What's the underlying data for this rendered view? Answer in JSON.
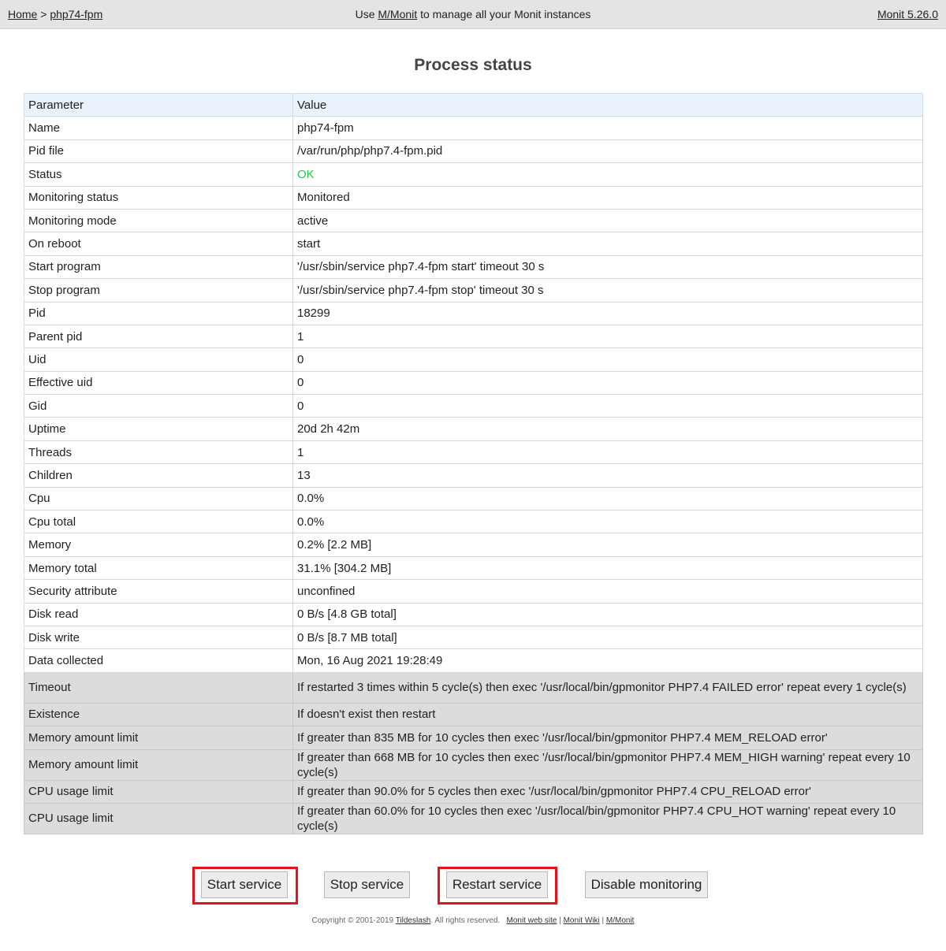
{
  "header": {
    "home": "Home",
    "separator": ">",
    "service": "php74-fpm",
    "promo_prefix": "Use",
    "promo_link": "M/Monit",
    "promo_suffix": "to manage all your Monit instances",
    "version": "Monit 5.26.0"
  },
  "page_title": "Process status",
  "table": {
    "head": [
      "Parameter",
      "Value"
    ],
    "rows": [
      [
        "Name",
        "php74-fpm"
      ],
      [
        "Pid file",
        "/var/run/php/php7.4-fpm.pid"
      ],
      [
        "Status",
        "OK"
      ],
      [
        "Monitoring status",
        "Monitored"
      ],
      [
        "Monitoring mode",
        "active"
      ],
      [
        "On reboot",
        "start"
      ],
      [
        "Start program",
        "'/usr/sbin/service php7.4-fpm start' timeout 30 s"
      ],
      [
        "Stop program",
        "'/usr/sbin/service php7.4-fpm stop' timeout 30 s"
      ],
      [
        "Pid",
        "18299"
      ],
      [
        "Parent pid",
        "1"
      ],
      [
        "Uid",
        "0"
      ],
      [
        "Effective uid",
        "0"
      ],
      [
        "Gid",
        "0"
      ],
      [
        "Uptime",
        "20d 2h 42m"
      ],
      [
        "Threads",
        "1"
      ],
      [
        "Children",
        "13"
      ],
      [
        "Cpu",
        "0.0%"
      ],
      [
        "Cpu total",
        "0.0%"
      ],
      [
        "Memory",
        "0.2% [2.2 MB]"
      ],
      [
        "Memory total",
        "31.1% [304.2 MB]"
      ],
      [
        "Security attribute",
        "unconfined"
      ],
      [
        "Disk read",
        "0 B/s [4.8 GB total]"
      ],
      [
        "Disk write",
        "0 B/s [8.7 MB total]"
      ],
      [
        "Data collected",
        "Mon, 16 Aug 2021 19:28:49"
      ]
    ],
    "rules": [
      [
        "Timeout",
        "If restarted 3 times within 5 cycle(s) then exec '/usr/local/bin/gpmonitor PHP7.4 FAILED error' repeat every 1 cycle(s)"
      ],
      [
        "Existence",
        "If doesn't exist then restart"
      ],
      [
        "Memory amount limit",
        "If greater than 835 MB for 10 cycles then exec '/usr/local/bin/gpmonitor PHP7.4 MEM_RELOAD error'"
      ],
      [
        "Memory amount limit",
        "If greater than 668 MB for 10 cycles then exec '/usr/local/bin/gpmonitor PHP7.4 MEM_HIGH warning' repeat every 10 cycle(s)"
      ],
      [
        "CPU usage limit",
        "If greater than 90.0% for 5 cycles then exec '/usr/local/bin/gpmonitor PHP7.4 CPU_RELOAD error'"
      ],
      [
        "CPU usage limit",
        "If greater than 60.0% for 10 cycles then exec '/usr/local/bin/gpmonitor PHP7.4 CPU_HOT warning' repeat every 10 cycle(s)"
      ]
    ]
  },
  "buttons": {
    "start": "Start service",
    "stop": "Stop service",
    "restart": "Restart service",
    "disable": "Disable monitoring"
  },
  "footer": {
    "copyright_prefix": "Copyright © 2001-2019",
    "company": "Tildeslash",
    "rights": ". All rights reserved.",
    "link1": "Monit web site",
    "link2": "Monit Wiki",
    "link3": "M/Monit",
    "divider": "|"
  },
  "colors": {
    "status_ok": "#26c64b",
    "highlight": "#e4141c",
    "header_bg": "#e4e4e4",
    "table_head_bg": "#eaf3fc",
    "rule_row_bg": "#dcdcdc"
  }
}
